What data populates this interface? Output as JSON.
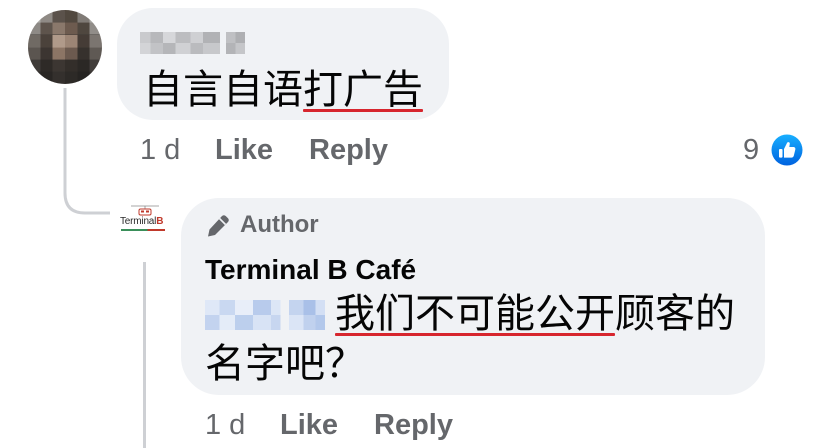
{
  "comments": [
    {
      "body_plain": "自言自语",
      "body_underlined": "打广告",
      "time": "1 d",
      "like_label": "Like",
      "reply_label": "Reply",
      "reaction_count": "9",
      "reaction_icon": "thumbs-up-icon"
    },
    {
      "badge_icon": "pencil-icon",
      "badge_label": "Author",
      "author_name": "Terminal B Café",
      "body_underlined": "我们不可能公开",
      "body_rest": "顾客的",
      "body_line2": "名字吧？",
      "time": "1 d",
      "like_label": "Like",
      "reply_label": "Reply",
      "avatar_logo": {
        "word": "Terminal",
        "letter": "B"
      }
    }
  ],
  "colors": {
    "bubble_background": "#f0f2f5",
    "text_primary": "#050505",
    "text_secondary": "#65676b",
    "annotation_underline": "#d7262e",
    "reaction_blue": "#1877f2",
    "thread_line": "#ced0d4"
  }
}
